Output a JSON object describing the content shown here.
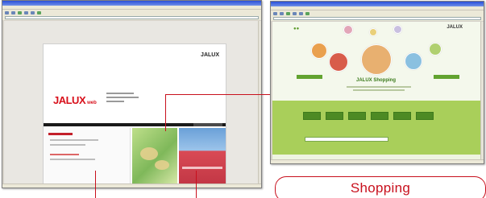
{
  "left_window": {
    "logo_small": "JALUX",
    "logo_main": "JALUX",
    "logo_suffix": "web"
  },
  "right_window": {
    "brand": "JALUX",
    "title": "JALUX Shopping"
  },
  "callout": {
    "label": "Shopping"
  },
  "colors": {
    "accent_red": "#c8101d",
    "jalux_red": "#d8101b",
    "shop_green": "#62a330",
    "lime": "#a9cf5a"
  }
}
